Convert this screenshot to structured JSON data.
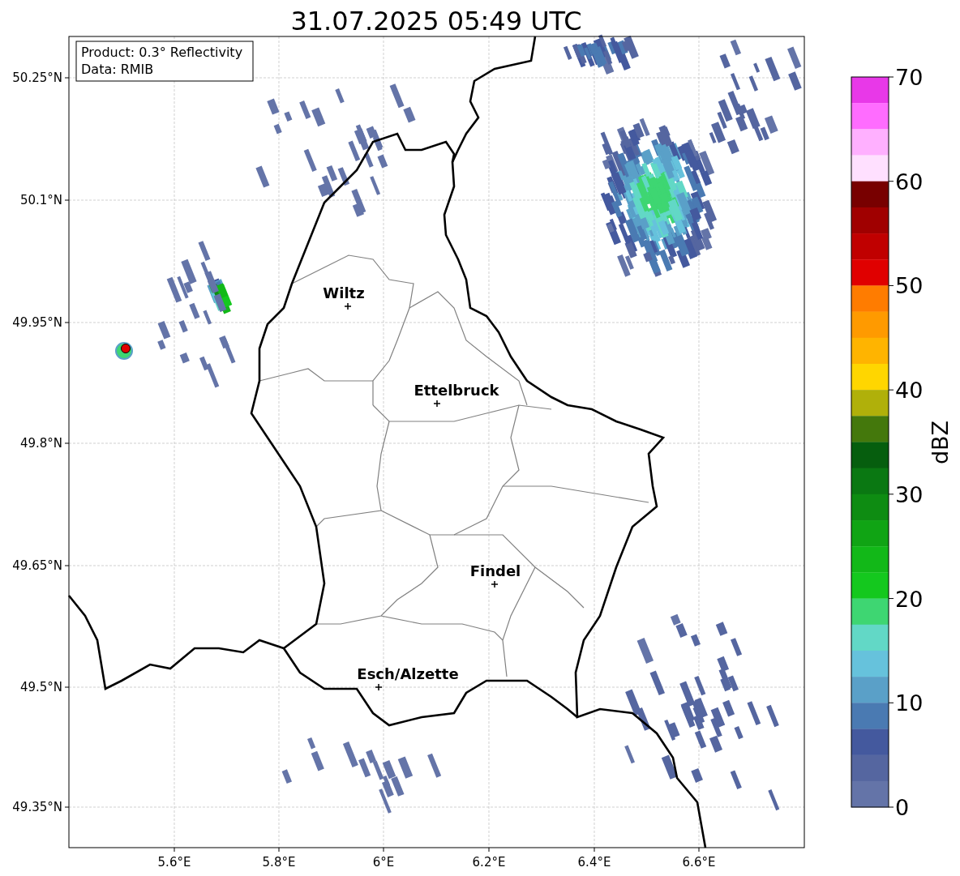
{
  "title": "31.07.2025 05:49 UTC",
  "legend": {
    "product": "Product: 0.3° Reflectivity",
    "data": "Data: RMIB"
  },
  "axes": {
    "yticks": [
      "50.25°N",
      "50.1°N",
      "49.95°N",
      "49.8°N",
      "49.65°N",
      "49.5°N",
      "49.35°N"
    ],
    "xticks": [
      "5.6°E",
      "5.8°E",
      "6°E",
      "6.2°E",
      "6.4°E",
      "6.6°E"
    ]
  },
  "cities": [
    {
      "name": "Wiltz"
    },
    {
      "name": "Ettelbruck"
    },
    {
      "name": "Findel"
    },
    {
      "name": "Esch/Alzette"
    }
  ],
  "colorbar": {
    "label": "dBZ",
    "ticks": [
      "70",
      "60",
      "50",
      "40",
      "30",
      "20",
      "10",
      "0"
    ],
    "bands": [
      {
        "color": "#e838e8"
      },
      {
        "color": "#ff6cff"
      },
      {
        "color": "#ffb0ff"
      },
      {
        "color": "#ffe0ff"
      },
      {
        "color": "#780000"
      },
      {
        "color": "#a00000"
      },
      {
        "color": "#c00000"
      },
      {
        "color": "#e00000"
      },
      {
        "color": "#ff7c00"
      },
      {
        "color": "#ff9a00"
      },
      {
        "color": "#ffb400"
      },
      {
        "color": "#ffd600"
      },
      {
        "color": "#b0b00a"
      },
      {
        "color": "#44780c"
      },
      {
        "color": "#065e0e"
      },
      {
        "color": "#0a7812"
      },
      {
        "color": "#0e8c12"
      },
      {
        "color": "#10a414"
      },
      {
        "color": "#12b818"
      },
      {
        "color": "#14c81e"
      },
      {
        "color": "#3ed672"
      },
      {
        "color": "#62d8c6"
      },
      {
        "color": "#66c2dc"
      },
      {
        "color": "#5aa0c8"
      },
      {
        "color": "#4a7ab2"
      },
      {
        "color": "#44599e"
      },
      {
        "color": "#5566a0"
      },
      {
        "color": "#6474a8"
      }
    ]
  }
}
